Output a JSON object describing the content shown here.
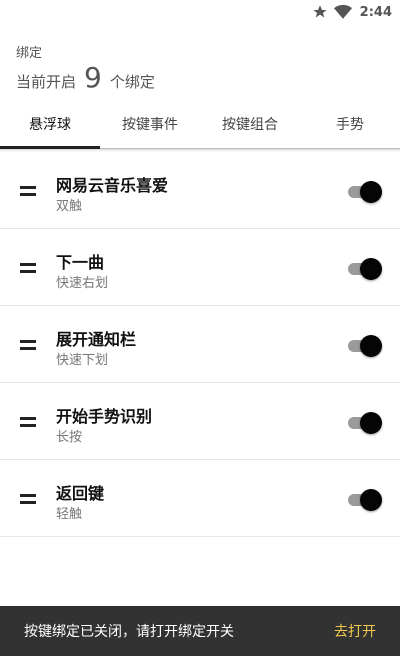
{
  "status_bar": {
    "time": "2:44",
    "icons": [
      "star-icon",
      "wifi-icon"
    ]
  },
  "header": {
    "subtitle": "绑定",
    "summary_prefix": "当前开启",
    "count": "9",
    "summary_suffix": "个绑定"
  },
  "tabs": [
    {
      "label": "悬浮球",
      "active": true
    },
    {
      "label": "按键事件",
      "active": false
    },
    {
      "label": "按键组合",
      "active": false
    },
    {
      "label": "手势",
      "active": false
    }
  ],
  "bindings": [
    {
      "title": "网易云音乐喜爱",
      "subtitle": "双触",
      "enabled": true
    },
    {
      "title": "下一曲",
      "subtitle": "快速右划",
      "enabled": true
    },
    {
      "title": "展开通知栏",
      "subtitle": "快速下划",
      "enabled": true
    },
    {
      "title": "开始手势识别",
      "subtitle": "长按",
      "enabled": true
    },
    {
      "title": "返回键",
      "subtitle": "轻触",
      "enabled": true
    }
  ],
  "snackbar": {
    "message": "按键绑定已关闭，请打开绑定开关",
    "action": "去打开",
    "action_color": "#f2c94c"
  }
}
